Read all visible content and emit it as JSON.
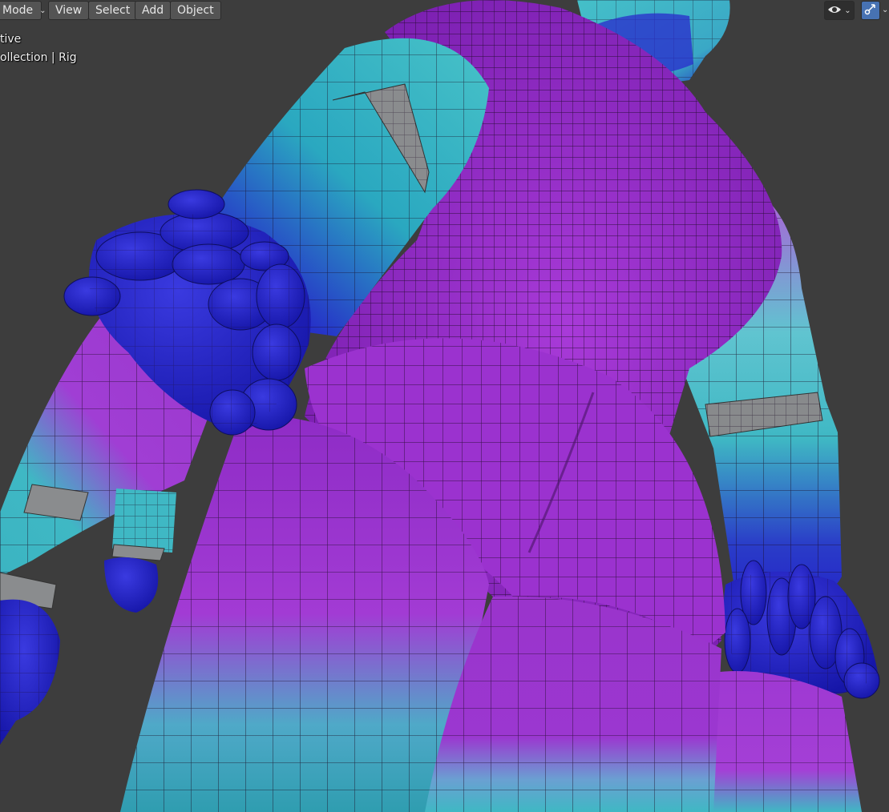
{
  "header": {
    "mode_label": "Mode",
    "menus": {
      "view": "View",
      "select": "Select",
      "add": "Add",
      "object": "Object"
    }
  },
  "overlay": {
    "line1": "tive",
    "line2": "ollection | Rig"
  },
  "colors": {
    "viewport_bg": "#3d3d3d",
    "magenta": "#9a2fd0",
    "cyan": "#3fb8c4",
    "blue": "#2424c8",
    "active_toggle": "#4772b3"
  },
  "icons": {
    "visibility": "eye-icon",
    "gizmo": "gizmo-icon"
  }
}
